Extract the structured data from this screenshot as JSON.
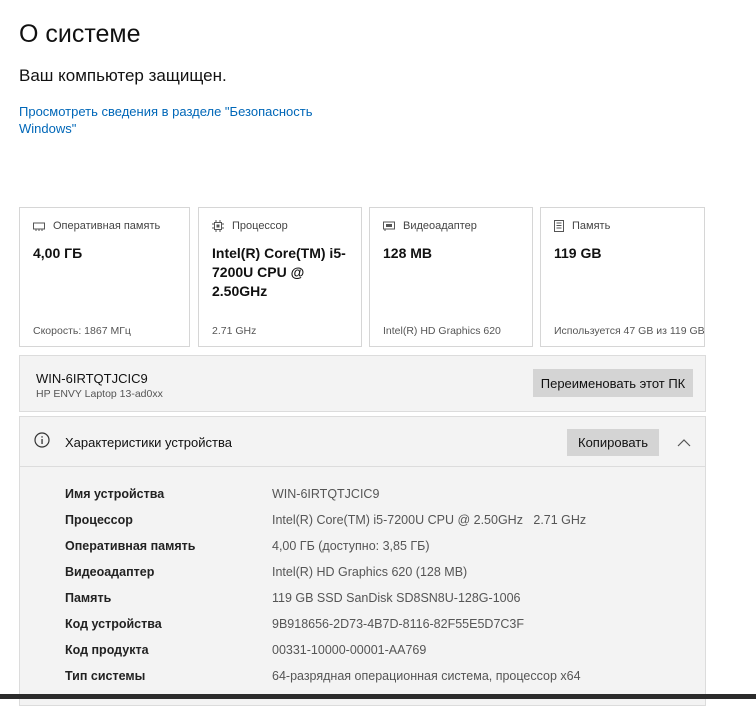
{
  "page": {
    "title": "О системе",
    "protection_status": "Ваш компьютер защищен.",
    "security_link": "Просмотреть сведения в разделе \"Безопасность Windows\""
  },
  "cards": [
    {
      "icon": "memory-icon",
      "label": "Оперативная память",
      "value": "4,00 ГБ",
      "sub": "Скорость: 1867 МГц"
    },
    {
      "icon": "processor-icon",
      "label": "Процессор",
      "value": "Intel(R) Core(TM) i5-7200U CPU @ 2.50GHz",
      "sub": "2.71 GHz"
    },
    {
      "icon": "display-adapter-icon",
      "label": "Видеоадаптер",
      "value": "128 MB",
      "sub": "Intel(R) HD Graphics 620"
    },
    {
      "icon": "storage-icon",
      "label": "Память",
      "value": "119 GB",
      "sub": "Используется 47 GB из 119 GB"
    }
  ],
  "pc": {
    "name": "WIN-6IRTQTJCIC9",
    "model": "HP ENVY Laptop 13-ad0xx",
    "rename_button": "Переименовать этот ПК"
  },
  "specs": {
    "title": "Характеристики устройства",
    "copy_button": "Копировать",
    "rows": [
      {
        "key": "Имя устройства",
        "value": "WIN-6IRTQTJCIC9"
      },
      {
        "key": "Процессор",
        "value": "Intel(R) Core(TM) i5-7200U CPU @ 2.50GHz   2.71 GHz"
      },
      {
        "key": "Оперативная память",
        "value": "4,00 ГБ (доступно: 3,85 ГБ)"
      },
      {
        "key": "Видеоадаптер",
        "value": "Intel(R) HD Graphics 620 (128 MB)"
      },
      {
        "key": "Память",
        "value": "119 GB SSD SanDisk SD8SN8U-128G-1006"
      },
      {
        "key": "Код устройства",
        "value": "9B918656-2D73-4B7D-8116-82F55E5D7C3F"
      },
      {
        "key": "Код продукта",
        "value": "00331-10000-00001-AA769"
      },
      {
        "key": "Тип системы",
        "value": "64-разрядная операционная система, процессор x64"
      }
    ]
  },
  "colors": {
    "accent": "#0067b8",
    "button": "#d4d4d4",
    "panel": "#f3f3f3"
  }
}
